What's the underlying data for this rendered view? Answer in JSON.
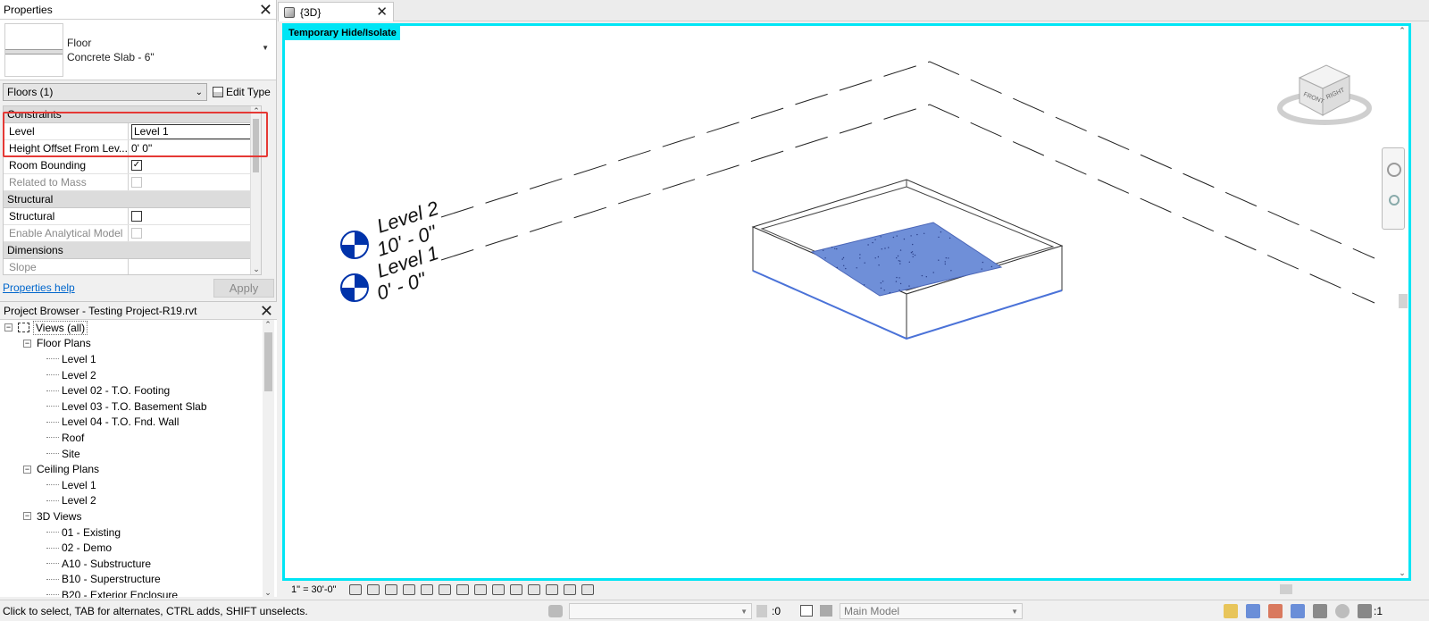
{
  "properties": {
    "title": "Properties",
    "type_family": "Floor",
    "type_name": "Concrete Slab - 6\"",
    "instance_filter": "Floors (1)",
    "edit_type": "Edit Type",
    "groups": {
      "constraints": "Constraints",
      "structural": "Structural",
      "dimensions": "Dimensions"
    },
    "rows": {
      "level_key": "Level",
      "level_value": "Level 1",
      "height_offset_key": "Height Offset From Lev...",
      "height_offset_value": "0'  0\"",
      "room_bounding_key": "Room Bounding",
      "related_mass_key": "Related to Mass",
      "structural_key": "Structural",
      "analytical_key": "Enable Analytical Model",
      "slope_key": "Slope"
    },
    "help_link": "Properties help",
    "apply": "Apply"
  },
  "browser": {
    "title": "Project Browser - Testing Project-R19.rvt",
    "root": "Views (all)",
    "floor_plans": "Floor Plans",
    "floor_plan_items": [
      "Level 1",
      "Level 2",
      "Level 02 - T.O. Footing",
      "Level 03 - T.O. Basement Slab",
      "Level 04 - T.O. Fnd. Wall",
      "Roof",
      "Site"
    ],
    "ceiling_plans": "Ceiling Plans",
    "ceiling_plan_items": [
      "Level 1",
      "Level 2"
    ],
    "views_3d": "3D Views",
    "views_3d_items": [
      "01 - Existing",
      "02 - Demo",
      "A10 - Substructure",
      "B10 - Superstructure",
      "B20 - Exterior Enclosure"
    ]
  },
  "view": {
    "tab_label": "{3D}",
    "badge": "Temporary Hide/Isolate",
    "level2_name": "Level 2",
    "level2_elev": "10' - 0\"",
    "level1_name": "Level 1",
    "level1_elev": "0' - 0\"",
    "cube_front": "FRONT",
    "cube_right": "RIGHT",
    "scale": "1\" = 30'-0\""
  },
  "status": {
    "text": "Click to select, TAB for alternates, CTRL adds, SHIFT unselects.",
    "zero": ":0",
    "model": "Main Model",
    "filter_count": ":1"
  },
  "colors": {
    "accent_cyan": "#00e5f5",
    "floor_fill": "#6f8fd8",
    "level_marker": "#0033aa",
    "highlight_red": "#e53935",
    "link_blue": "#0066cc"
  }
}
